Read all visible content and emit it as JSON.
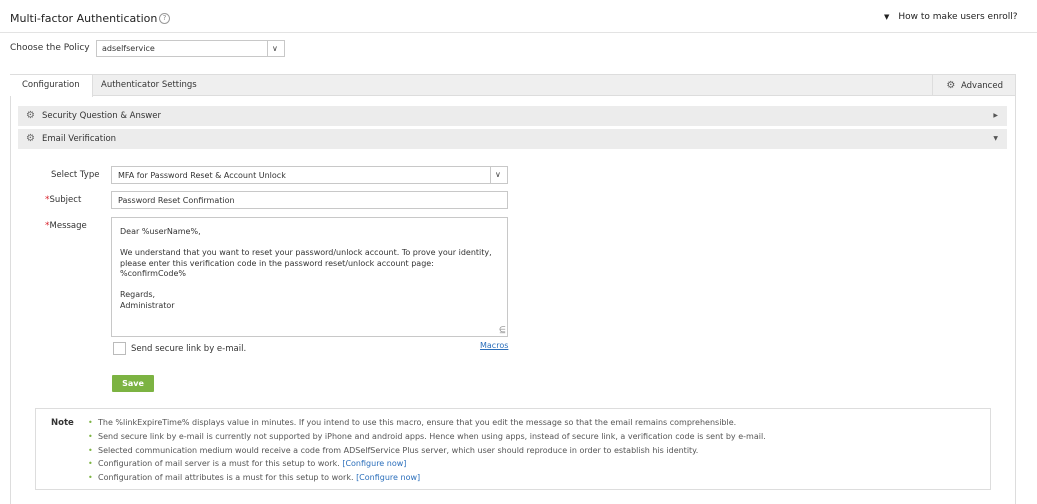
{
  "header": {
    "title": "Multi-factor Authentication",
    "help_icon": "?",
    "enroll_link": "How to make users enroll?"
  },
  "policy": {
    "label": "Choose the Policy",
    "value": "adselfservice"
  },
  "tabs": [
    {
      "label": "Configuration",
      "active": true
    },
    {
      "label": "Authenticator Settings",
      "active": false
    }
  ],
  "advanced_label": "Advanced",
  "accordion": [
    {
      "label": "Security Question & Answer",
      "expanded": false
    },
    {
      "label": "Email Verification",
      "expanded": true
    }
  ],
  "form": {
    "select_type_label": "Select Type",
    "select_type_value": "MFA for Password Reset & Account Unlock",
    "subject_label": "Subject",
    "subject_value": "Password Reset Confirmation",
    "message_label": "Message",
    "message_lines": [
      "Dear %userName%,",
      "",
      "We understand that you want to reset your password/unlock account. To prove your identity,",
      "please enter this verification code in the password reset/unlock account page:",
      "%confirmCode%",
      "",
      "Regards,",
      "Administrator"
    ],
    "secure_link_label": "Send secure link by e-mail.",
    "secure_link_checked": false,
    "macros_label": "Macros",
    "save_label": "Save"
  },
  "note": {
    "title": "Note",
    "items": [
      {
        "text": "The %linkExpireTime% displays value in minutes. If you intend to use this macro, ensure that you edit the message so that the email remains comprehensible.",
        "link": ""
      },
      {
        "text": "Send secure link by e-mail is currently not supported by iPhone and android apps. Hence when using apps, instead of secure link, a verification code is sent by e-mail.",
        "link": ""
      },
      {
        "text": "Selected communication medium would receive a code from ADSelfService Plus server, which user should reproduce in order to establish his identity.",
        "link": ""
      },
      {
        "text": "Configuration of mail server is a must for this setup to work.",
        "link": "[Configure now]"
      },
      {
        "text": "Configuration of mail attributes is a must for this setup to work.",
        "link": "[Configure now]"
      }
    ]
  },
  "colors": {
    "accent_green": "#7cb342",
    "link_blue": "#2a6ebb",
    "required_red": "#d9232d"
  }
}
